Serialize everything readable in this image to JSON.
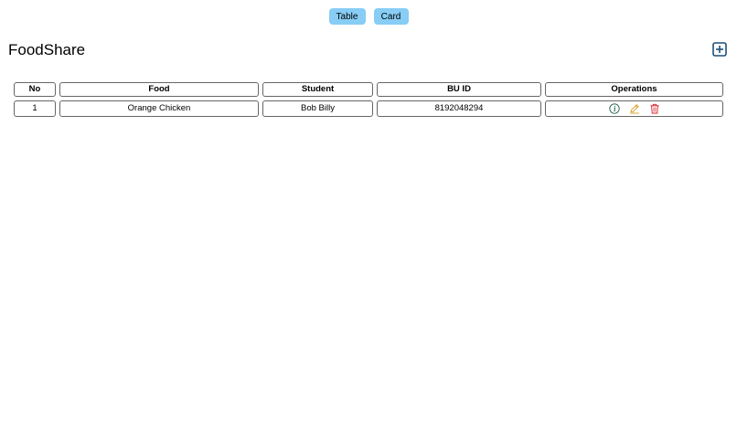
{
  "view_toggle": {
    "table_label": "Table",
    "card_label": "Card"
  },
  "header": {
    "title": "FoodShare",
    "add_icon": "plus-square-icon"
  },
  "table": {
    "columns": [
      "No",
      "Food",
      "Student",
      "BU ID",
      "Operations"
    ],
    "rows": [
      {
        "no": "1",
        "food": "Orange Chicken",
        "student": "Bob Billy",
        "bu_id": "8192048294",
        "operations": [
          "info-icon",
          "edit-icon",
          "delete-icon"
        ]
      }
    ]
  },
  "colors": {
    "toggle_bg": "#87cdf5",
    "add_icon": "#1e4f7a",
    "info_icon": "#1f5c4a",
    "edit_icon": "#d99a1a",
    "delete_icon": "#d8232a"
  }
}
